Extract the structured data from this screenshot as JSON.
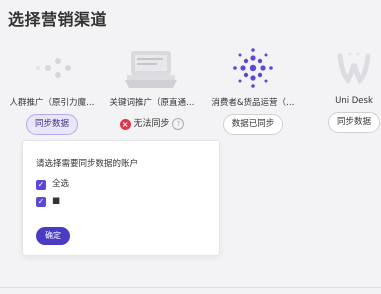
{
  "page": {
    "title": "选择营销渠道"
  },
  "channels": [
    {
      "label": "人群推广（原引力魔…",
      "action": "同步数据",
      "icon": "audience-icon"
    },
    {
      "label": "关键词推广（原直通…",
      "status": "无法同步",
      "icon": "keyword-icon"
    },
    {
      "label": "消费者&货品运营（…",
      "action": "数据已同步",
      "icon": "consumer-icon"
    },
    {
      "label": "Uni Desk",
      "action": "同步数据",
      "icon": "unidesk-icon"
    }
  ],
  "popover": {
    "title": "请选择需要同步数据的账户",
    "options": [
      {
        "label": "全选",
        "checked": true
      },
      {
        "label": "■",
        "checked": true
      }
    ],
    "confirm": "确定"
  },
  "colors": {
    "accent": "#4a3bc4",
    "error": "#e1364a"
  }
}
